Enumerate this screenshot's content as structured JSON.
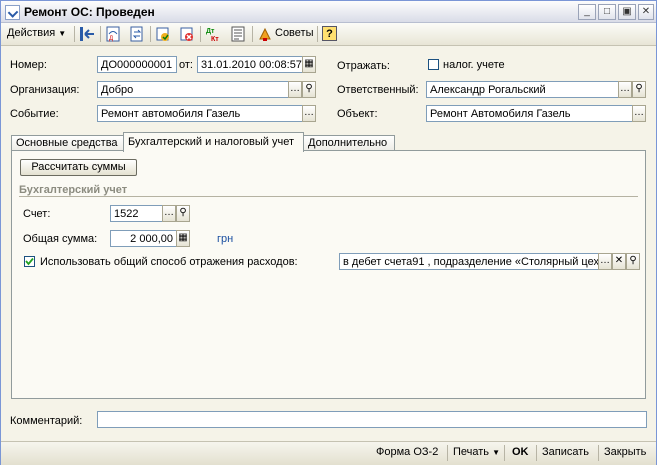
{
  "window": {
    "title": "Ремонт ОС: Проведен"
  },
  "toolbar": {
    "actions_label": "Действия",
    "advice_label": "Советы",
    "help_label": "?"
  },
  "header": {
    "number_label": "Номер:",
    "number_value": "ДО000000001",
    "from_label": "от:",
    "date_value": "31.01.2010 00:08:57",
    "org_label": "Организация:",
    "org_value": "Добро",
    "event_label": "Событие:",
    "event_value": "Ремонт автомобиля Газель",
    "reflect_label": "Отражать:",
    "tax_checkbox_label": "налог. учете",
    "responsible_label": "Ответственный:",
    "responsible_value": "Александр Рогальский",
    "object_label": "Объект:",
    "object_value": "Ремонт Автомобиля Газель"
  },
  "tabs": [
    {
      "label": "Основные средства"
    },
    {
      "label": "Бухгалтерский и налоговый учет"
    },
    {
      "label": "Дополнительно"
    }
  ],
  "panel": {
    "calc_button": "Рассчитать суммы",
    "section_title": "Бухгалтерский учет",
    "account_label": "Счет:",
    "account_value": "1522",
    "total_label": "Общая сумма:",
    "total_value": "2 000,00",
    "currency": "грн",
    "common_method_label": "Использовать общий способ отражения расходов:",
    "common_method_checked": true,
    "common_method_value": "в дебет счета91 , подразделение «Столярный цех"
  },
  "comment": {
    "label": "Комментарий:",
    "value": ""
  },
  "footer": {
    "form_label": "Форма ОЗ-2",
    "print_label": "Печать",
    "ok_label": "OK",
    "save_label": "Записать",
    "close_label": "Закрыть"
  }
}
